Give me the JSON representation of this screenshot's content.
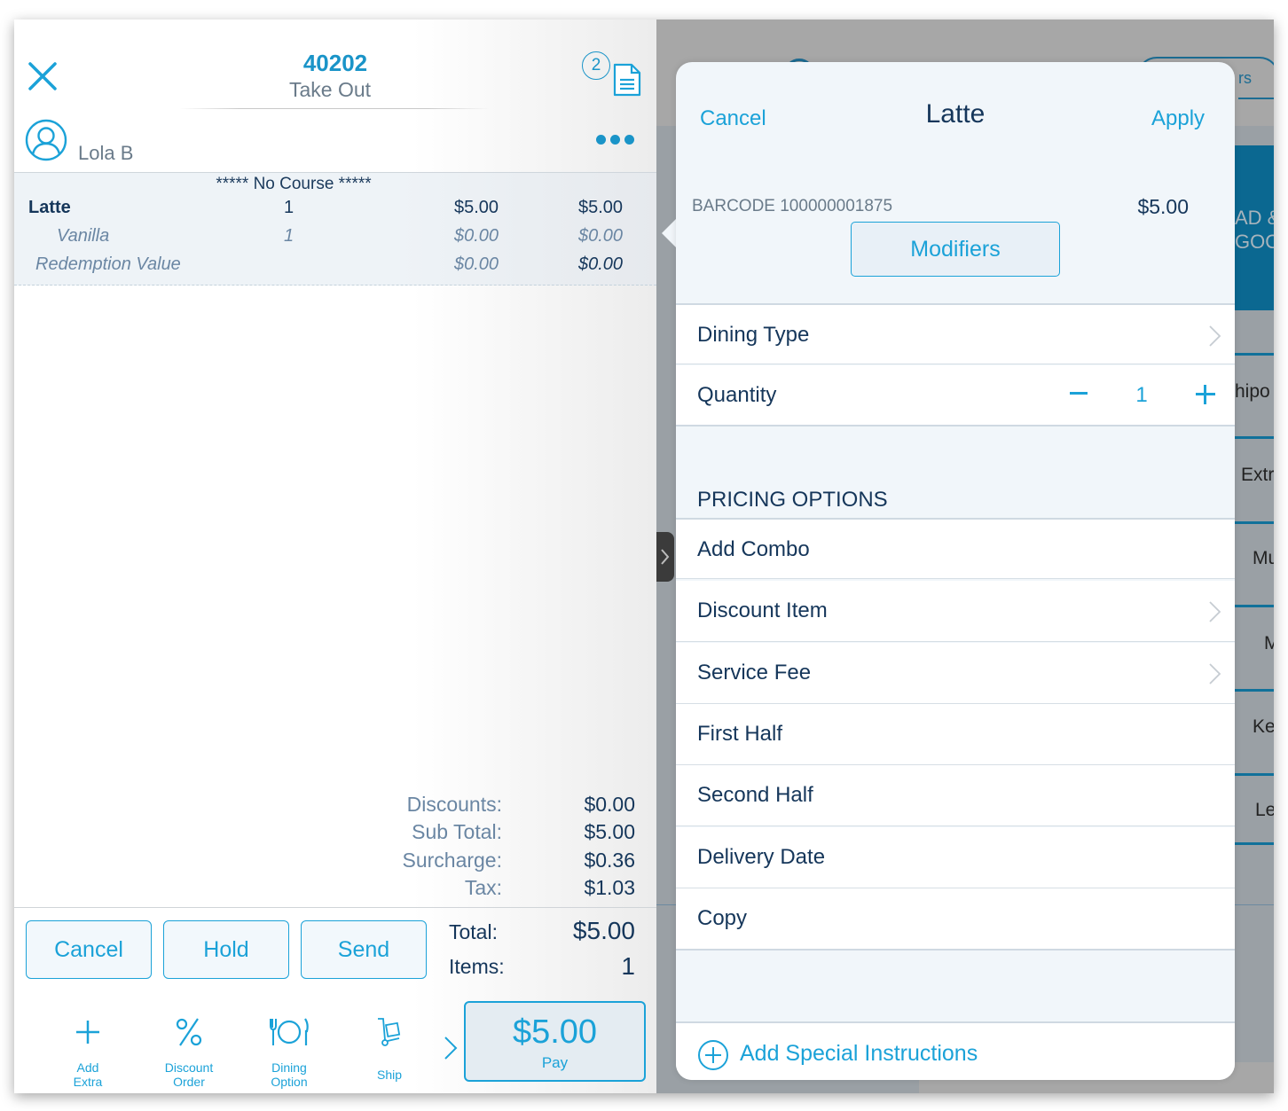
{
  "order": {
    "number": "40202",
    "type": "Take Out",
    "receipt_count": "2",
    "customer": "Lola B",
    "course_label": "***** No Course *****",
    "items": [
      {
        "name": "Latte",
        "qty": "1",
        "price": "$5.00",
        "total": "$5.00"
      },
      {
        "name": "Vanilla",
        "qty": "1",
        "price": "$0.00",
        "total": "$0.00"
      },
      {
        "name": "Redemption Value",
        "qty": "",
        "price": "$0.00",
        "total": "$0.00"
      }
    ],
    "summary": [
      {
        "label": "Discounts:",
        "value": "$0.00"
      },
      {
        "label": "Sub Total:",
        "value": "$5.00"
      },
      {
        "label": "Surcharge:",
        "value": "$0.36"
      },
      {
        "label": "Tax:",
        "value": "$1.03"
      }
    ],
    "total_label": "Total:",
    "total_value": "$5.00",
    "items_label": "Items:",
    "items_value": "1"
  },
  "actions": {
    "cancel": "Cancel",
    "hold": "Hold",
    "send": "Send"
  },
  "toolbar": [
    {
      "label_line1": "Add",
      "label_line2": "Extra",
      "icon": "plus-icon"
    },
    {
      "label_line1": "Discount",
      "label_line2": "Order",
      "icon": "percent-icon"
    },
    {
      "label_line1": "Dining",
      "label_line2": "Option",
      "icon": "dining-icon"
    },
    {
      "label_line1": "Ship",
      "label_line2": "",
      "icon": "cart-icon"
    }
  ],
  "pay": {
    "amount": "$5.00",
    "label": "Pay"
  },
  "background": {
    "header_tab_fragment": "rs",
    "category_fragment_line1": "AD &",
    "category_fragment_line2": "GOO",
    "menu_fragments": [
      "hipo",
      "Extr",
      "Mu",
      "M",
      "Ke",
      "Le"
    ]
  },
  "popover": {
    "cancel": "Cancel",
    "title": "Latte",
    "apply": "Apply",
    "barcode": "BARCODE 100000001875",
    "price": "$5.00",
    "modifiers": "Modifiers",
    "dining_type": "Dining Type",
    "quantity_label": "Quantity",
    "quantity_value": "1",
    "pricing_section": "PRICING OPTIONS",
    "pricing_options": [
      {
        "label": "Add Combo",
        "chevron": false
      },
      {
        "label": "Discount Item",
        "chevron": true
      },
      {
        "label": "Service Fee",
        "chevron": true
      },
      {
        "label": "First Half",
        "chevron": false
      },
      {
        "label": "Second Half",
        "chevron": false
      },
      {
        "label": "Delivery Date",
        "chevron": false
      },
      {
        "label": "Copy",
        "chevron": false
      }
    ],
    "special_instructions": "Add Special Instructions"
  },
  "colors": {
    "accent": "#1ba2d8",
    "navy_text": "#15365a",
    "muted_text": "#6a86a3",
    "category_blue": "#0b6891"
  }
}
